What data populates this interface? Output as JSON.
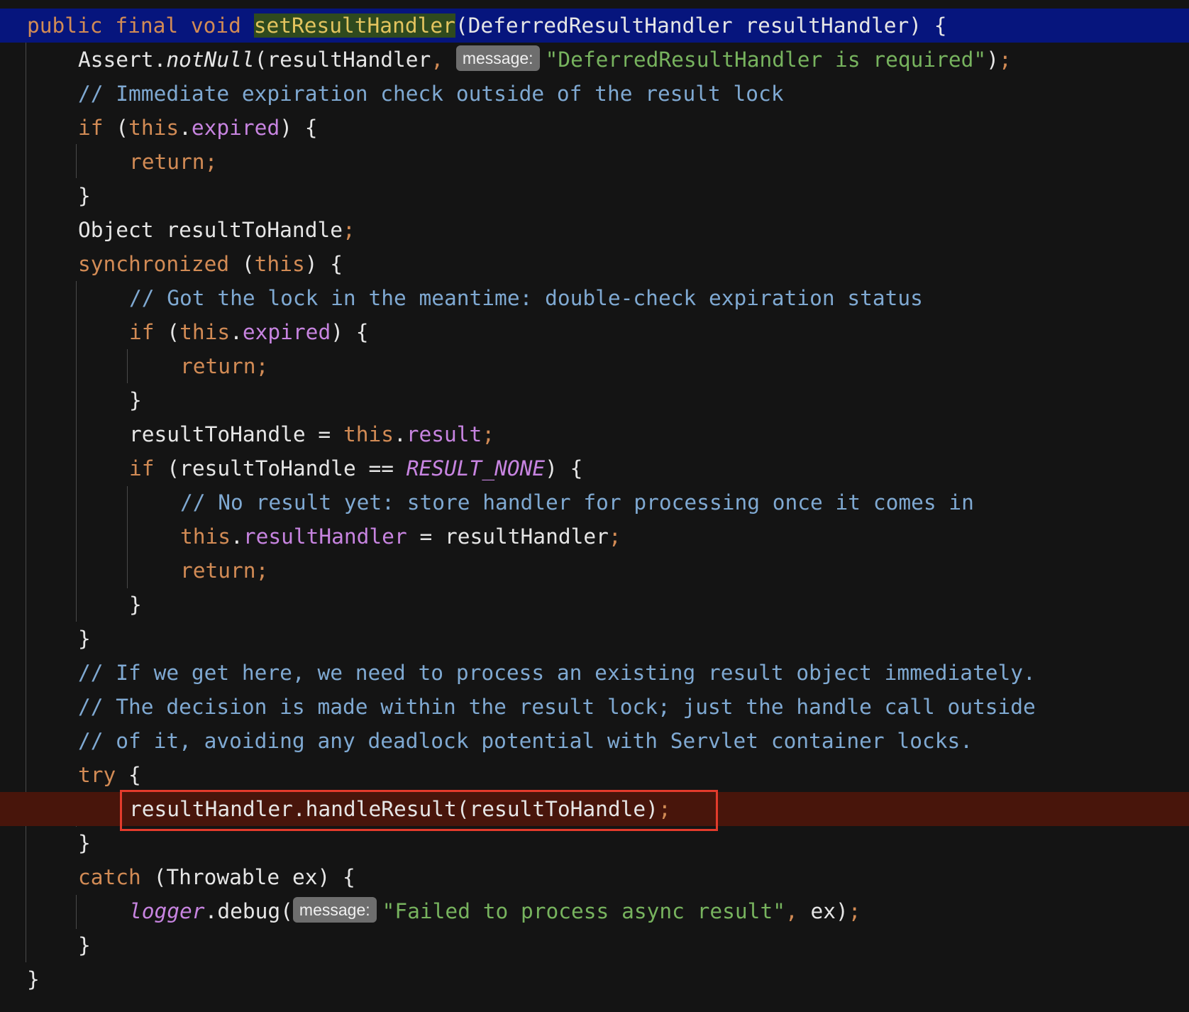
{
  "editor": {
    "lines": [
      {
        "segments": [
          {
            "t": "public final void ",
            "c": "k"
          },
          {
            "t": "setResultHandler",
            "c": "fn-hl"
          },
          {
            "t": "(DeferredResultHandler resultHandler) {",
            "c": "p"
          }
        ]
      },
      {
        "segments": [
          {
            "t": "Assert.",
            "c": "p"
          },
          {
            "t": "notNull",
            "c": "p i"
          },
          {
            "t": "(resultHandler",
            "c": "p"
          },
          {
            "t": ", ",
            "c": "semi"
          },
          {
            "hint": "message:"
          },
          {
            "t": "\"DeferredResultHandler is required\"",
            "c": "s"
          },
          {
            "t": ")",
            "c": "p"
          },
          {
            "t": ";",
            "c": "semi"
          }
        ]
      },
      {
        "segments": [
          {
            "t": "// Immediate expiration check outside of the result lock",
            "c": "c"
          }
        ]
      },
      {
        "segments": [
          {
            "t": "if",
            "c": "k"
          },
          {
            "t": " (",
            "c": "p"
          },
          {
            "t": "this",
            "c": "k"
          },
          {
            "t": ".",
            "c": "p"
          },
          {
            "t": "expired",
            "c": "f"
          },
          {
            "t": ") {",
            "c": "p"
          }
        ]
      },
      {
        "segments": [
          {
            "t": "return;",
            "c": "k"
          }
        ]
      },
      {
        "segments": [
          {
            "t": "}",
            "c": "p"
          }
        ]
      },
      {
        "segments": [
          {
            "t": "Object resultToHandle",
            "c": "p"
          },
          {
            "t": ";",
            "c": "semi"
          }
        ]
      },
      {
        "segments": [
          {
            "t": "synchronized",
            "c": "k"
          },
          {
            "t": " (",
            "c": "p"
          },
          {
            "t": "this",
            "c": "k"
          },
          {
            "t": ") {",
            "c": "p"
          }
        ]
      },
      {
        "segments": [
          {
            "t": "// Got the lock in the meantime: double-check expiration status",
            "c": "c"
          }
        ]
      },
      {
        "segments": [
          {
            "t": "if",
            "c": "k"
          },
          {
            "t": " (",
            "c": "p"
          },
          {
            "t": "this",
            "c": "k"
          },
          {
            "t": ".",
            "c": "p"
          },
          {
            "t": "expired",
            "c": "f"
          },
          {
            "t": ") {",
            "c": "p"
          }
        ]
      },
      {
        "segments": [
          {
            "t": "return;",
            "c": "k"
          }
        ]
      },
      {
        "segments": [
          {
            "t": "}",
            "c": "p"
          }
        ]
      },
      {
        "segments": [
          {
            "t": "resultToHandle = ",
            "c": "p"
          },
          {
            "t": "this",
            "c": "k"
          },
          {
            "t": ".",
            "c": "p"
          },
          {
            "t": "result",
            "c": "f"
          },
          {
            "t": ";",
            "c": "semi"
          }
        ]
      },
      {
        "segments": [
          {
            "t": "if",
            "c": "k"
          },
          {
            "t": " (resultToHandle == ",
            "c": "p"
          },
          {
            "t": "RESULT_NONE",
            "c": "f i"
          },
          {
            "t": ") {",
            "c": "p"
          }
        ]
      },
      {
        "segments": [
          {
            "t": "// No result yet: store handler for processing once it comes in",
            "c": "c"
          }
        ]
      },
      {
        "segments": [
          {
            "t": "this",
            "c": "k"
          },
          {
            "t": ".",
            "c": "p"
          },
          {
            "t": "resultHandler",
            "c": "f"
          },
          {
            "t": " = resultHandler",
            "c": "p"
          },
          {
            "t": ";",
            "c": "semi"
          }
        ]
      },
      {
        "segments": [
          {
            "t": "return;",
            "c": "k"
          }
        ]
      },
      {
        "segments": [
          {
            "t": "}",
            "c": "p"
          }
        ]
      },
      {
        "segments": [
          {
            "t": "}",
            "c": "p"
          }
        ]
      },
      {
        "segments": [
          {
            "t": "// If we get here, we need to process an existing result object immediately.",
            "c": "c"
          }
        ]
      },
      {
        "segments": [
          {
            "t": "// The decision is made within the result lock; just the handle call outside",
            "c": "c"
          }
        ]
      },
      {
        "segments": [
          {
            "t": "// of it, avoiding any deadlock potential with Servlet container locks.",
            "c": "c"
          }
        ]
      },
      {
        "segments": [
          {
            "t": "try",
            "c": "k"
          },
          {
            "t": " {",
            "c": "p"
          }
        ]
      },
      {
        "segments": [
          {
            "t": "resultHandler.handleResult(resultToHandle)",
            "c": "p"
          },
          {
            "t": ";",
            "c": "semi"
          }
        ]
      },
      {
        "segments": [
          {
            "t": "}",
            "c": "p"
          }
        ]
      },
      {
        "segments": [
          {
            "t": "catch",
            "c": "k"
          },
          {
            "t": " (Throwable ex) {",
            "c": "p"
          }
        ]
      },
      {
        "segments": [
          {
            "t": "logger",
            "c": "f i"
          },
          {
            "t": ".debug(",
            "c": "p"
          },
          {
            "hint": "message:"
          },
          {
            "t": "\"Failed to process async result\"",
            "c": "s"
          },
          {
            "t": ", ",
            "c": "semi"
          },
          {
            "t": "ex)",
            "c": "p"
          },
          {
            "t": ";",
            "c": "semi"
          }
        ]
      },
      {
        "segments": [
          {
            "t": "}",
            "c": "p"
          }
        ]
      },
      {
        "segments": [
          {
            "t": "}",
            "c": "p"
          }
        ]
      }
    ]
  },
  "colors": {
    "background": "#141414",
    "signature_line_bg": "#06157d",
    "execution_line_bg": "#48150b",
    "highlight_box": "#e33b2c",
    "keyword": "#d28b55",
    "comment": "#7fa9d2",
    "string": "#77b35e",
    "field": "#c784e0",
    "method_highlight": "#e3c45e"
  }
}
